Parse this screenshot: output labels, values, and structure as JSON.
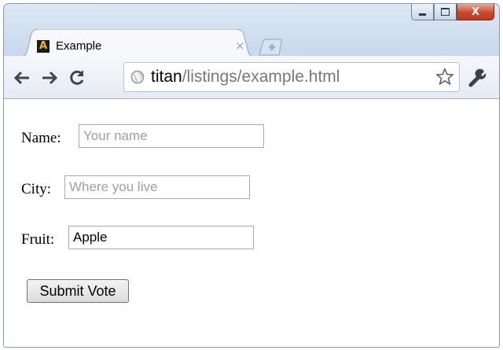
{
  "window": {
    "controls": [
      "minimize-icon",
      "maximize-icon",
      "close-icon"
    ],
    "close_glyph": "X"
  },
  "tab": {
    "favicon_letter": "A",
    "title": "Example",
    "close_glyph": "×"
  },
  "toolbar": {
    "back_icon": "back-arrow-icon",
    "forward_icon": "forward-arrow-icon",
    "reload_icon": "reload-icon",
    "url_host": "titan",
    "url_path": "/listings/example.html",
    "bookmark_icon": "star-icon",
    "menu_icon": "wrench-icon"
  },
  "form": {
    "name_label": "Name:",
    "name_placeholder": "Your name",
    "name_value": "",
    "city_label": "City:",
    "city_placeholder": "Where you live",
    "city_value": "",
    "fruit_label": "Fruit:",
    "fruit_value": "Apple",
    "submit_label": "Submit Vote"
  },
  "colors": {
    "frame": "#c9d9ee",
    "close_button": "#c9492d",
    "favicon_accent": "#f6b60c"
  }
}
